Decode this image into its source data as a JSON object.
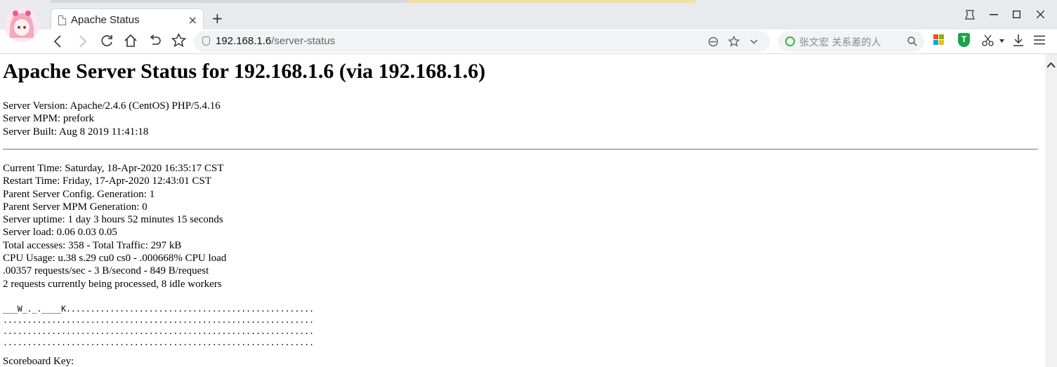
{
  "browser": {
    "tab": {
      "title": "Apache Status",
      "close_glyph": "×"
    },
    "new_tab_glyph": "+",
    "address": {
      "host": "192.168.1.6",
      "path": "/server-status"
    },
    "search": {
      "placeholder": "张文宏 关系差的人"
    }
  },
  "page": {
    "heading": "Apache Server Status for 192.168.1.6 (via 192.168.1.6)",
    "server_info": [
      "Server Version: Apache/2.4.6 (CentOS) PHP/5.4.16",
      "Server MPM: prefork",
      "Server Built: Aug 8 2019 11:41:18"
    ],
    "status_lines": [
      "Current Time: Saturday, 18-Apr-2020 16:35:17 CST",
      "Restart Time: Friday, 17-Apr-2020 12:43:01 CST",
      "Parent Server Config. Generation: 1",
      "Parent Server MPM Generation: 0",
      "Server uptime: 1 day 3 hours 52 minutes 15 seconds",
      "Server load: 0.06 0.03 0.05",
      "Total accesses: 358 - Total Traffic: 297 kB",
      "CPU Usage: u.38 s.29 cu0 cs0 - .000668% CPU load",
      ".00357 requests/sec - 3 B/second - 849 B/request",
      "2 requests currently being processed, 8 idle workers"
    ],
    "scoreboard": [
      "___W_._.____K...................................................",
      "................................................................",
      "................................................................",
      "................................................................"
    ],
    "scoreboard_key_label": "Scoreboard Key:"
  },
  "colors": {
    "ms_red": "#f25022",
    "ms_green": "#7fba00",
    "ms_blue": "#00a4ef",
    "ms_yellow": "#ffb900",
    "shield_green": "#1aa34a",
    "search_ring": "#39b54a"
  }
}
